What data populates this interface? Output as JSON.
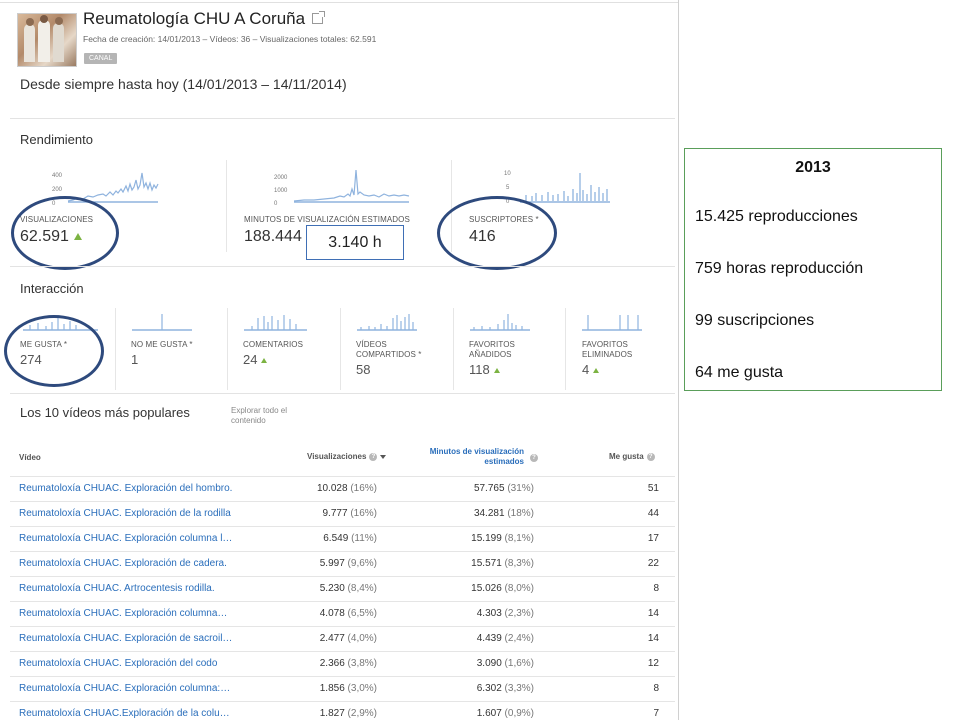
{
  "channel": {
    "title": "Reumatología CHU A Coruña",
    "meta": "Fecha de creación: 14/01/2013 – Vídeos: 36 – Visualizaciones totales: 62.591",
    "badge": "CANAL",
    "date_range": "Desde siempre hasta hoy (14/01/2013 – 14/11/2014)"
  },
  "rendimiento": {
    "title": "Rendimiento",
    "metrics": [
      {
        "label": "VISUALIZACIONES",
        "value": "62.591",
        "axis": [
          "400",
          "200",
          "0"
        ]
      },
      {
        "label": "MINUTOS DE VISUALIZACIÓN ESTIMADOS",
        "value": "188.444",
        "axis": [
          "2000",
          "1000",
          "0"
        ]
      },
      {
        "label": "SUSCRIPTORES *",
        "value": "416",
        "axis": [
          "10",
          "5",
          "0"
        ]
      }
    ]
  },
  "hours_box": "3.140 h",
  "interaccion": {
    "title": "Interacción",
    "metrics": [
      {
        "label1": "ME GUSTA *",
        "label2": "",
        "value": "274"
      },
      {
        "label1": "NO ME GUSTA *",
        "label2": "",
        "value": "1"
      },
      {
        "label1": "COMENTARIOS",
        "label2": "",
        "value": "24"
      },
      {
        "label1": "VÍDEOS",
        "label2": "COMPARTIDOS *",
        "value": "58"
      },
      {
        "label1": "FAVORITOS",
        "label2": "AÑADIDOS",
        "value": "118"
      },
      {
        "label1": "FAVORITOS",
        "label2": "ELIMINADOS",
        "value": "4"
      }
    ]
  },
  "top_videos": {
    "title": "Los 10 vídeos más populares",
    "explore": "Explorar todo el contenido",
    "columns": {
      "video": "Vídeo",
      "views": "Visualizaciones",
      "minutes_l1": "Minutos de visualización",
      "minutes_l2": "estimados",
      "likes": "Me gusta"
    },
    "rows": [
      {
        "title": "Reumatoloxía CHUAC. Exploración del hombro.",
        "views": "10.028",
        "views_pct": "(16%)",
        "minutes": "57.765",
        "minutes_pct": "(31%)",
        "likes": "51"
      },
      {
        "title": "Reumatoloxía CHUAC. Exploración de la rodilla",
        "views": "9.777",
        "views_pct": "(16%)",
        "minutes": "34.281",
        "minutes_pct": "(18%)",
        "likes": "44"
      },
      {
        "title": "Reumatoloxía CHUAC. Exploración columna l…",
        "views": "6.549",
        "views_pct": "(11%)",
        "minutes": "15.199",
        "minutes_pct": "(8,1%)",
        "likes": "17"
      },
      {
        "title": "Reumatoloxía CHUAC. Exploración de cadera.",
        "views": "5.997",
        "views_pct": "(9,6%)",
        "minutes": "15.571",
        "minutes_pct": "(8,3%)",
        "likes": "22"
      },
      {
        "title": "Reumatoloxía CHUAC. Artrocentesis rodilla.",
        "views": "5.230",
        "views_pct": "(8,4%)",
        "minutes": "15.026",
        "minutes_pct": "(8,0%)",
        "likes": "8"
      },
      {
        "title": "Reumatoloxía CHUAC. Exploración columna…",
        "views": "4.078",
        "views_pct": "(6,5%)",
        "minutes": "4.303",
        "minutes_pct": "(2,3%)",
        "likes": "14"
      },
      {
        "title": "Reumatoloxía CHUAC. Exploración de sacroil…",
        "views": "2.477",
        "views_pct": "(4,0%)",
        "minutes": "4.439",
        "minutes_pct": "(2,4%)",
        "likes": "14"
      },
      {
        "title": "Reumatoloxía CHUAC. Exploración del codo",
        "views": "2.366",
        "views_pct": "(3,8%)",
        "minutes": "3.090",
        "minutes_pct": "(1,6%)",
        "likes": "12"
      },
      {
        "title": "Reumatoloxía CHUAC. Exploración columna:…",
        "views": "1.856",
        "views_pct": "(3,0%)",
        "minutes": "6.302",
        "minutes_pct": "(3,3%)",
        "likes": "8"
      },
      {
        "title": "Reumatoloxía CHUAC.Exploración de la colu…",
        "views": "1.827",
        "views_pct": "(2,9%)",
        "minutes": "1.607",
        "minutes_pct": "(0,9%)",
        "likes": "7"
      }
    ]
  },
  "note": {
    "year": "2013",
    "lines": [
      "15.425  reproducciones",
      "759  horas  reproducción",
      "99  suscripciones",
      "64 me gusta"
    ]
  },
  "colors": {
    "accent": "#2a6ebb",
    "spark": "#8fb3de",
    "oval": "#2e4a7d",
    "up": "#7cb342",
    "note_border": "#5a9e5a"
  }
}
